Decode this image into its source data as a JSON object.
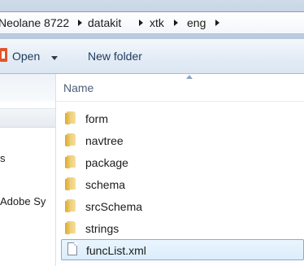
{
  "breadcrumb": {
    "items": [
      "Neolane 8722",
      "datakit",
      "xtk",
      "eng"
    ]
  },
  "toolbar": {
    "open_label": "Open",
    "new_folder_label": "New folder"
  },
  "nav": {
    "items": [
      "s",
      "Adobe Sy"
    ]
  },
  "list": {
    "column_name": "Name",
    "items": [
      {
        "name": "form",
        "type": "folder"
      },
      {
        "name": "navtree",
        "type": "folder"
      },
      {
        "name": "package",
        "type": "folder"
      },
      {
        "name": "schema",
        "type": "folder"
      },
      {
        "name": "srcSchema",
        "type": "folder"
      },
      {
        "name": "strings",
        "type": "folder"
      },
      {
        "name": "funcList.xml",
        "type": "file",
        "selected": true
      }
    ]
  }
}
